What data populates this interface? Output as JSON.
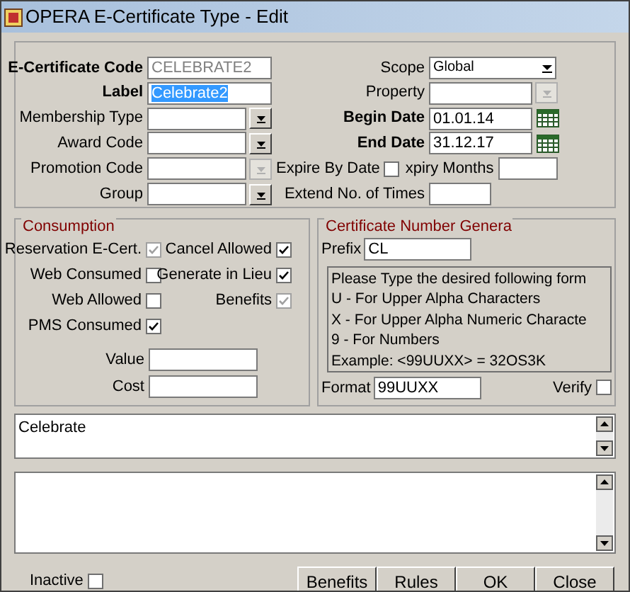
{
  "window": {
    "title": "OPERA E-Certificate Type - Edit"
  },
  "left_fields": [
    {
      "label": "E-Certificate Code",
      "required": true,
      "kind": "text",
      "value": "CELEBRATE2",
      "disabled": true,
      "selected": false
    },
    {
      "label": "Label",
      "required": true,
      "kind": "text",
      "value": "Celebrate2",
      "disabled": false,
      "selected": true
    },
    {
      "label": "Membership Type",
      "required": false,
      "kind": "dropdown",
      "disabled": false,
      "selected": false
    },
    {
      "label": "Award Code",
      "required": false,
      "kind": "dropdown",
      "disabled": false,
      "selected": false
    },
    {
      "label": "Promotion Code",
      "required": false,
      "kind": "dropdown",
      "disabled": true,
      "selected": false
    },
    {
      "label": "Group",
      "required": false,
      "kind": "dropdown",
      "disabled": false,
      "selected": false
    }
  ],
  "right_fields": [
    {
      "label": "Scope",
      "required": false,
      "kind": "select",
      "value": "Global",
      "disabled": false
    },
    {
      "label": "Property",
      "required": false,
      "kind": "dropdown",
      "disabled": true
    },
    {
      "label": "Begin Date",
      "required": true,
      "kind": "date",
      "value": "01.01.14",
      "disabled": false
    },
    {
      "label": "End Date",
      "required": true,
      "kind": "date",
      "value": "31.12.17",
      "disabled": false
    }
  ],
  "expire_by_date": {
    "label": "Expire By Date",
    "checked": false
  },
  "expiry_months": {
    "label": "xpiry Months"
  },
  "extend_times": {
    "label": "Extend No. of Times"
  },
  "consumption": {
    "title": "Consumption",
    "checkboxes": [
      {
        "label": "Reservation E-Cert.",
        "checked": true,
        "disabled": true
      },
      {
        "label": "Cancel Allowed",
        "checked": true,
        "disabled": false
      },
      {
        "label": "Web Consumed",
        "checked": false,
        "disabled": false
      },
      {
        "label": "Generate in Lieu",
        "checked": true,
        "disabled": false
      },
      {
        "label": "Web Allowed",
        "checked": false,
        "disabled": false
      },
      {
        "label": "Benefits",
        "checked": true,
        "disabled": true
      },
      {
        "label": "PMS Consumed",
        "checked": true,
        "disabled": false
      }
    ],
    "value": {
      "label": "Value"
    },
    "cost": {
      "label": "Cost"
    }
  },
  "certificate_number": {
    "title": "Certificate Number Genera",
    "prefix": {
      "label": "Prefix",
      "value": "CL"
    },
    "help_lines": [
      "Please Type the desired following form",
      "U - For Upper Alpha Characters",
      "X - For Upper Alpha Numeric Characte",
      "9 - For Numbers",
      "Example: <99UUXX> = 32OS3K"
    ],
    "format": {
      "label": "Format",
      "value": "99UUXX"
    },
    "verify": {
      "label": "Verify",
      "checked": false
    }
  },
  "description": "Celebrate",
  "inactive": {
    "label": "Inactive",
    "checked": false
  },
  "buttons": [
    "Benefits",
    "Rules",
    "OK",
    "Close"
  ]
}
